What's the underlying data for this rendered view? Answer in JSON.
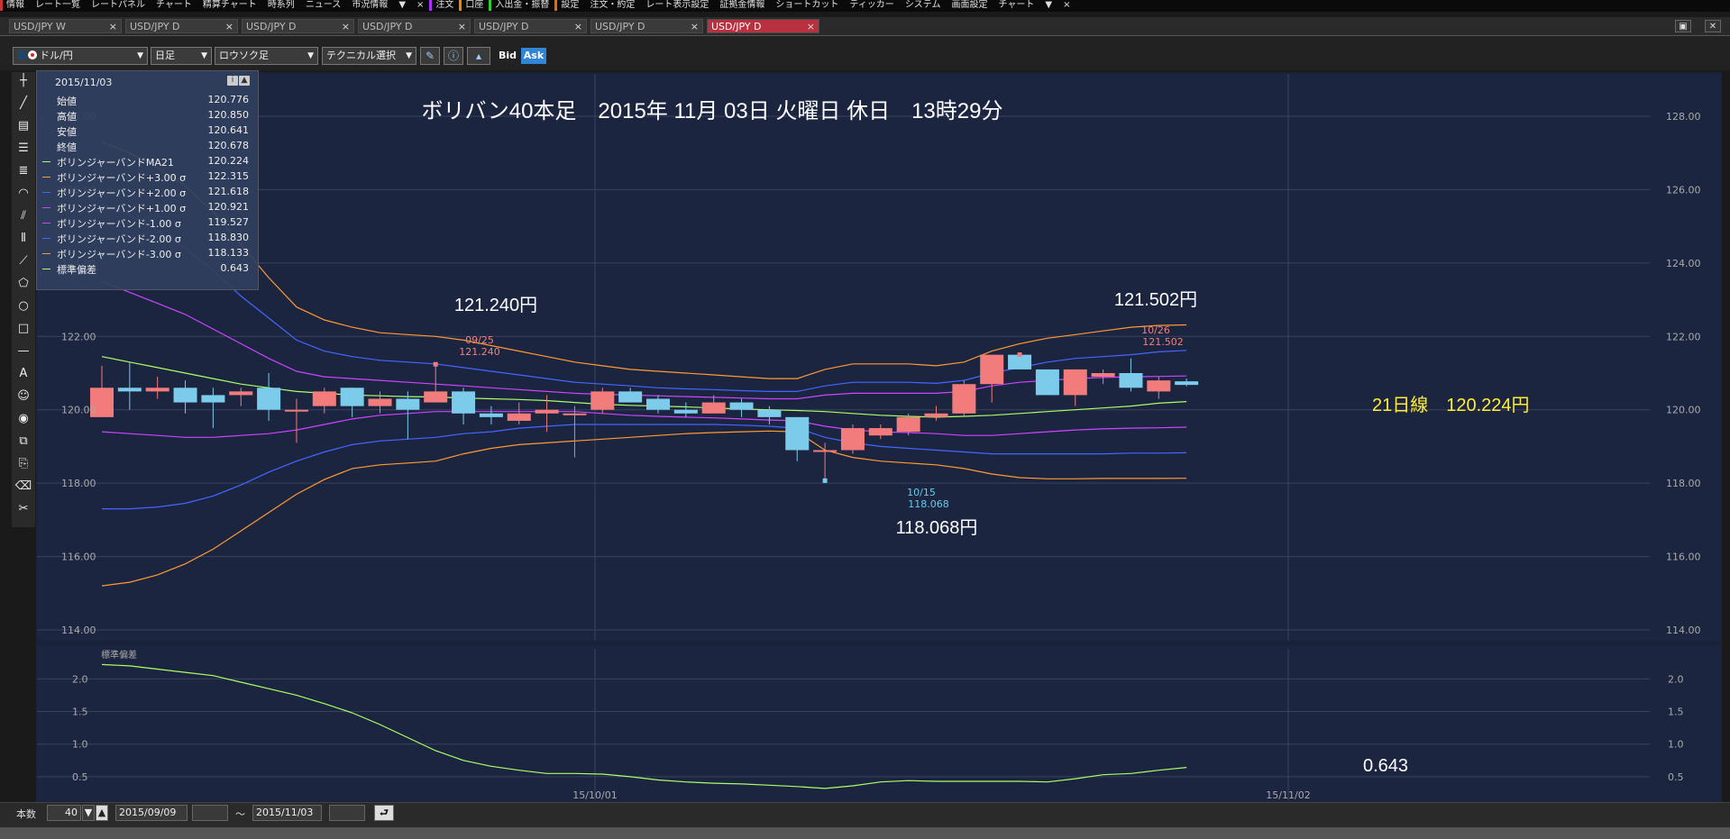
{
  "menu": {
    "items": [
      "情報",
      "レート一覧",
      "レートパネル",
      "チャート",
      "精算チャート",
      "時系列",
      "ニュース",
      "市況情報",
      "▼",
      "×",
      "注文",
      "口座",
      "入出金・振替",
      "設定",
      "注文・約定",
      "レート表示設定",
      "証拠金情報",
      "ショートカット",
      "ティッカー",
      "システム",
      "画面設定",
      "チャート",
      "▼",
      "×"
    ]
  },
  "tabs": [
    {
      "label": "USD/JPY W",
      "close": "×"
    },
    {
      "label": "USD/JPY D",
      "close": "×"
    },
    {
      "label": "USD/JPY D",
      "close": "×"
    },
    {
      "label": "USD/JPY D",
      "close": "×"
    },
    {
      "label": "USD/JPY D",
      "close": "×"
    },
    {
      "label": "USD/JPY D",
      "close": "×"
    },
    {
      "label": "USD/JPY D",
      "close": "×"
    }
  ],
  "toolbar": {
    "pair": "ドル/円",
    "period": "日足",
    "chart_type": "ロウソク足",
    "technical": "テクニカル選択",
    "bid": "Bid",
    "ask": "Ask"
  },
  "info_panel": {
    "date": "2015/11/03",
    "rows": [
      {
        "label": "始値",
        "value": "120.776",
        "color": ""
      },
      {
        "label": "高値",
        "value": "120.850",
        "color": ""
      },
      {
        "label": "安値",
        "value": "120.641",
        "color": ""
      },
      {
        "label": "終値",
        "value": "120.678",
        "color": ""
      },
      {
        "label": "ボリンジャーバンドMA21",
        "value": "120.224",
        "color": "#aaff66"
      },
      {
        "label": "ボリンジャーバンド+3.00 σ",
        "value": "122.315",
        "color": "#ff9933"
      },
      {
        "label": "ボリンジャーバンド+2.00 σ",
        "value": "121.618",
        "color": "#4466ff"
      },
      {
        "label": "ボリンジャーバンド+1.00 σ",
        "value": "120.921",
        "color": "#cc44ff"
      },
      {
        "label": "ボリンジャーバンド-1.00 σ",
        "value": "119.527",
        "color": "#cc44ff"
      },
      {
        "label": "ボリンジャーバンド-2.00 σ",
        "value": "118.830",
        "color": "#4466ff"
      },
      {
        "label": "ボリンジャーバンド-3.00 σ",
        "value": "118.133",
        "color": "#ff9933"
      },
      {
        "label": "標準偏差",
        "value": "0.643",
        "color": "#aaff66"
      }
    ]
  },
  "annotations": {
    "title": "ボリバン40本足　2015年 11月 03日 火曜日 休日　13時29分",
    "high_left": "121.240円",
    "high_left_marker": [
      "09/25",
      "121.240"
    ],
    "high_right": "121.502円",
    "high_right_marker": [
      "10/26",
      "121.502"
    ],
    "low": "118.068円",
    "low_marker": [
      "10/15",
      "118.068"
    ],
    "ma_label": "21日線　120.224円",
    "stdev_label": "0.643"
  },
  "chart_data": [
    {
      "type": "candlestick",
      "title": "ボリバン40本足　2015年 11月 03日 火曜日 休日　13時29分",
      "y_ticks": [
        "128.00",
        "126.00",
        "124.00",
        "122.00",
        "120.00",
        "118.00",
        "116.00",
        "114.00"
      ],
      "ylim": [
        114,
        128
      ],
      "x_ticks": [
        "15/10/01",
        "15/11/02"
      ],
      "candles": [
        {
          "o": 119.8,
          "h": 121.2,
          "l": 119.8,
          "c": 120.6
        },
        {
          "o": 120.6,
          "h": 121.3,
          "l": 120.0,
          "c": 120.5
        },
        {
          "o": 120.5,
          "h": 120.9,
          "l": 120.3,
          "c": 120.6
        },
        {
          "o": 120.6,
          "h": 120.8,
          "l": 119.9,
          "c": 120.2
        },
        {
          "o": 120.4,
          "h": 120.6,
          "l": 119.5,
          "c": 120.2
        },
        {
          "o": 120.4,
          "h": 120.6,
          "l": 120.1,
          "c": 120.5
        },
        {
          "o": 120.6,
          "h": 121.0,
          "l": 119.7,
          "c": 120.0
        },
        {
          "o": 120.0,
          "h": 120.3,
          "l": 119.1,
          "c": 120.0
        },
        {
          "o": 120.1,
          "h": 120.6,
          "l": 119.9,
          "c": 120.5
        },
        {
          "o": 120.6,
          "h": 120.6,
          "l": 119.8,
          "c": 120.1
        },
        {
          "o": 120.1,
          "h": 120.5,
          "l": 119.9,
          "c": 120.3
        },
        {
          "o": 120.3,
          "h": 120.5,
          "l": 119.2,
          "c": 120.0
        },
        {
          "o": 120.2,
          "h": 121.24,
          "l": 120.2,
          "c": 120.5
        },
        {
          "o": 120.5,
          "h": 120.6,
          "l": 119.6,
          "c": 119.9
        },
        {
          "o": 119.9,
          "h": 120.1,
          "l": 119.6,
          "c": 119.8
        },
        {
          "o": 119.7,
          "h": 120.2,
          "l": 119.6,
          "c": 119.9
        },
        {
          "o": 119.9,
          "h": 120.4,
          "l": 119.4,
          "c": 120.0
        },
        {
          "o": 119.9,
          "h": 120.1,
          "l": 118.7,
          "c": 119.9
        },
        {
          "o": 120.0,
          "h": 120.6,
          "l": 119.9,
          "c": 120.5
        },
        {
          "o": 120.5,
          "h": 120.6,
          "l": 120.2,
          "c": 120.2
        },
        {
          "o": 120.3,
          "h": 120.4,
          "l": 119.9,
          "c": 120.0
        },
        {
          "o": 120.0,
          "h": 120.2,
          "l": 119.8,
          "c": 119.9
        },
        {
          "o": 119.9,
          "h": 120.4,
          "l": 119.9,
          "c": 120.2
        },
        {
          "o": 120.2,
          "h": 120.3,
          "l": 119.8,
          "c": 120.0
        },
        {
          "o": 120.0,
          "h": 120.1,
          "l": 119.6,
          "c": 119.8
        },
        {
          "o": 119.8,
          "h": 119.8,
          "l": 118.6,
          "c": 118.9
        },
        {
          "o": 118.9,
          "h": 119.1,
          "l": 118.068,
          "c": 118.9
        },
        {
          "o": 118.9,
          "h": 119.6,
          "l": 118.8,
          "c": 119.5
        },
        {
          "o": 119.3,
          "h": 119.6,
          "l": 119.2,
          "c": 119.5
        },
        {
          "o": 119.4,
          "h": 119.9,
          "l": 119.3,
          "c": 119.8
        },
        {
          "o": 119.8,
          "h": 120.1,
          "l": 119.7,
          "c": 119.9
        },
        {
          "o": 119.9,
          "h": 120.8,
          "l": 119.8,
          "c": 120.7
        },
        {
          "o": 120.7,
          "h": 121.5,
          "l": 120.2,
          "c": 121.5
        },
        {
          "o": 121.5,
          "h": 121.502,
          "l": 121.1,
          "c": 121.1
        },
        {
          "o": 121.1,
          "h": 121.1,
          "l": 120.4,
          "c": 120.4
        },
        {
          "o": 120.4,
          "h": 121.1,
          "l": 120.1,
          "c": 121.1
        },
        {
          "o": 120.9,
          "h": 121.1,
          "l": 120.7,
          "c": 121.0
        },
        {
          "o": 121.0,
          "h": 121.4,
          "l": 120.5,
          "c": 120.6
        },
        {
          "o": 120.5,
          "h": 120.9,
          "l": 120.3,
          "c": 120.8
        },
        {
          "o": 120.776,
          "h": 120.85,
          "l": 120.641,
          "c": 120.678
        }
      ],
      "series": [
        {
          "name": "ボリンジャーバンドMA21",
          "color": "#aaff66",
          "values": [
            121.45,
            121.3,
            121.15,
            121.0,
            120.85,
            120.7,
            120.6,
            120.5,
            120.45,
            120.4,
            120.38,
            120.36,
            120.35,
            120.32,
            120.3,
            120.28,
            120.25,
            120.2,
            120.15,
            120.12,
            120.1,
            120.08,
            120.05,
            120.02,
            120.0,
            119.98,
            119.95,
            119.9,
            119.85,
            119.82,
            119.8,
            119.82,
            119.85,
            119.9,
            119.95,
            120.0,
            120.05,
            120.1,
            120.18,
            120.224
          ]
        },
        {
          "name": "ボリンジャーバンド+3.00 σ",
          "color": "#ff9933",
          "values": [
            127.3,
            127.0,
            126.6,
            126.1,
            125.4,
            124.5,
            123.6,
            122.8,
            122.45,
            122.25,
            122.1,
            122.05,
            122.0,
            121.9,
            121.75,
            121.6,
            121.45,
            121.3,
            121.2,
            121.1,
            121.05,
            121.0,
            120.95,
            120.9,
            120.85,
            120.85,
            121.1,
            121.25,
            121.25,
            121.25,
            121.2,
            121.3,
            121.6,
            121.8,
            121.95,
            122.05,
            122.15,
            122.25,
            122.3,
            122.315
          ]
        },
        {
          "name": "ボリンジャーバンド+2.00 σ",
          "color": "#4466ff",
          "values": [
            125.6,
            125.3,
            124.9,
            124.4,
            123.8,
            123.1,
            122.5,
            121.9,
            121.6,
            121.45,
            121.35,
            121.3,
            121.25,
            121.15,
            121.05,
            120.95,
            120.85,
            120.75,
            120.7,
            120.65,
            120.6,
            120.57,
            120.55,
            120.52,
            120.5,
            120.5,
            120.65,
            120.75,
            120.75,
            120.75,
            120.72,
            120.8,
            121.0,
            121.15,
            121.3,
            121.4,
            121.45,
            121.5,
            121.58,
            121.618
          ]
        },
        {
          "name": "ボリンジャーバンド+1.00 σ",
          "color": "#cc44ff",
          "values": [
            123.5,
            123.2,
            122.9,
            122.6,
            122.2,
            121.8,
            121.4,
            121.05,
            120.9,
            120.85,
            120.8,
            120.75,
            120.7,
            120.65,
            120.6,
            120.55,
            120.5,
            120.45,
            120.42,
            120.4,
            120.38,
            120.36,
            120.34,
            120.32,
            120.3,
            120.3,
            120.4,
            120.45,
            120.45,
            120.45,
            120.45,
            120.5,
            120.65,
            120.75,
            120.8,
            120.85,
            120.88,
            120.9,
            120.91,
            120.921
          ]
        },
        {
          "name": "ボリンジャーバンド-1.00 σ",
          "color": "#cc44ff",
          "values": [
            119.4,
            119.35,
            119.3,
            119.25,
            119.25,
            119.3,
            119.35,
            119.45,
            119.6,
            119.75,
            119.85,
            119.9,
            119.95,
            119.95,
            119.95,
            119.95,
            119.95,
            119.95,
            119.9,
            119.85,
            119.82,
            119.8,
            119.78,
            119.75,
            119.72,
            119.7,
            119.55,
            119.45,
            119.4,
            119.38,
            119.35,
            119.3,
            119.3,
            119.35,
            119.4,
            119.45,
            119.48,
            119.5,
            119.51,
            119.527
          ]
        },
        {
          "name": "ボリンジャーバンド-2.00 σ",
          "color": "#4466ff",
          "values": [
            117.3,
            117.3,
            117.35,
            117.45,
            117.65,
            117.95,
            118.3,
            118.6,
            118.85,
            119.05,
            119.15,
            119.2,
            119.25,
            119.35,
            119.4,
            119.5,
            119.55,
            119.6,
            119.6,
            119.6,
            119.6,
            119.6,
            119.6,
            119.58,
            119.55,
            119.5,
            119.25,
            119.1,
            119.0,
            118.95,
            118.9,
            118.85,
            118.8,
            118.8,
            118.8,
            118.8,
            118.8,
            118.82,
            118.82,
            118.83
          ]
        },
        {
          "name": "ボリンジャーバンド-3.00 σ",
          "color": "#ff9933",
          "values": [
            115.2,
            115.3,
            115.5,
            115.8,
            116.2,
            116.7,
            117.2,
            117.7,
            118.1,
            118.4,
            118.5,
            118.55,
            118.6,
            118.8,
            118.95,
            119.05,
            119.1,
            119.15,
            119.2,
            119.25,
            119.3,
            119.35,
            119.38,
            119.4,
            119.42,
            119.4,
            118.9,
            118.7,
            118.6,
            118.55,
            118.5,
            118.4,
            118.25,
            118.15,
            118.12,
            118.12,
            118.13,
            118.13,
            118.13,
            118.133
          ]
        }
      ]
    },
    {
      "type": "line",
      "title": "標準偏差",
      "y_ticks": [
        "2.0",
        "1.5",
        "1.0",
        "0.5"
      ],
      "ylim": [
        0.25,
        2.35
      ],
      "series": [
        {
          "name": "標準偏差",
          "color": "#aaff66",
          "values": [
            2.22,
            2.2,
            2.15,
            2.1,
            2.05,
            1.95,
            1.85,
            1.75,
            1.62,
            1.48,
            1.3,
            1.1,
            0.9,
            0.75,
            0.66,
            0.6,
            0.55,
            0.55,
            0.54,
            0.5,
            0.45,
            0.42,
            0.4,
            0.39,
            0.37,
            0.35,
            0.32,
            0.36,
            0.42,
            0.44,
            0.43,
            0.43,
            0.43,
            0.43,
            0.42,
            0.47,
            0.53,
            0.55,
            0.6,
            0.643
          ]
        }
      ]
    }
  ],
  "bottom": {
    "bars_label": "本数",
    "bars_value": "40",
    "from": "2015/09/09",
    "tilde": "～",
    "to": "2015/11/03"
  }
}
